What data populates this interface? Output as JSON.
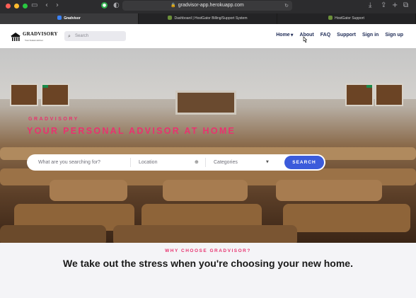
{
  "browser": {
    "url": "gradvisor-app.herokuapp.com",
    "tabs": [
      {
        "label": "Gradvisor",
        "active": true
      },
      {
        "label": "Dashboard | HostGator Billing/Support System",
        "active": false
      },
      {
        "label": "HostGator Support",
        "active": false
      }
    ],
    "icons": [
      "sidebar-icon",
      "back-icon",
      "forward-icon",
      "shield-icon",
      "lock-icon",
      "reload-icon",
      "download-icon",
      "share-icon",
      "new-tab-icon",
      "tab-overview-icon"
    ]
  },
  "site": {
    "logo": {
      "name": "GRADVISORY",
      "tagline": "Your Student Advisor"
    },
    "search": {
      "placeholder": "Search"
    },
    "menu": [
      {
        "label": "Home",
        "has_dropdown": true
      },
      {
        "label": "About"
      },
      {
        "label": "FAQ"
      },
      {
        "label": "Support"
      },
      {
        "label": "Sign in"
      },
      {
        "label": "Sign up"
      }
    ],
    "hero": {
      "subtitle": "GRADVISORY",
      "title": "YOUR PERSONAL ADVISOR AT HOME",
      "search_placeholder": "What are you searching for?",
      "location_placeholder": "Location",
      "category_label": "Categories",
      "button": "SEARCH"
    },
    "section": {
      "kicker": "WHY CHOOSE GRADVISOR?",
      "headline": "We take out the stress when you're choosing your new home."
    },
    "colors": {
      "accent": "#e8336f",
      "button": "#3b5bdb",
      "nav_text": "#1d2a55"
    }
  }
}
